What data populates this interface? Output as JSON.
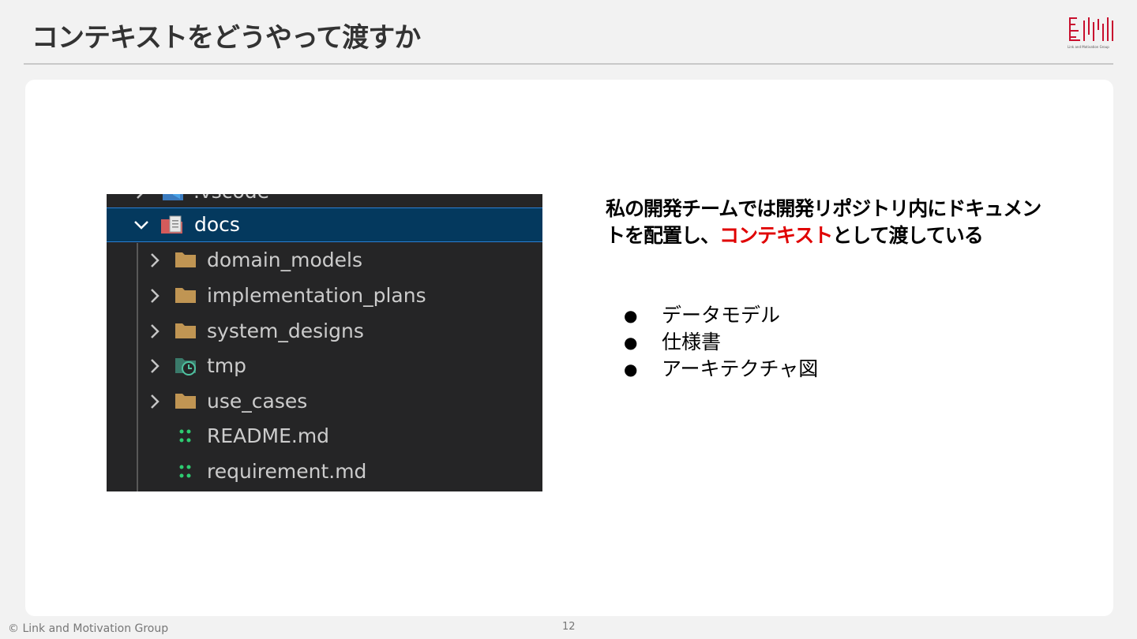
{
  "slide": {
    "title": "コンテキストをどうやって渡すか",
    "logo_text": "Link and Motivation Group",
    "copyright": "© Link and Motivation Group",
    "page_number": "12"
  },
  "explorer": {
    "partial_item": ".vscode",
    "selected_folder": "docs",
    "items": [
      {
        "label": "domain_models",
        "icon": "folder-icon",
        "expandable": true
      },
      {
        "label": "implementation_plans",
        "icon": "folder-icon",
        "expandable": true
      },
      {
        "label": "system_designs",
        "icon": "folder-icon",
        "expandable": true
      },
      {
        "label": "tmp",
        "icon": "temp-folder-icon",
        "expandable": true
      },
      {
        "label": "use_cases",
        "icon": "folder-icon",
        "expandable": true
      },
      {
        "label": "README.md",
        "icon": "markdown-file-icon",
        "expandable": false
      },
      {
        "label": "requirement.md",
        "icon": "markdown-file-icon",
        "expandable": false
      }
    ],
    "colors": {
      "background": "#252526",
      "selected": "#04395e",
      "folder": "#c09553",
      "markdown": "#2ecc71"
    }
  },
  "description": {
    "line_part1": "私の開発チームでは開発リポジトリ内にドキュメントを配置し、",
    "accent": "コンテキスト",
    "line_part2": "として渡している",
    "accent_color": "#e00000"
  },
  "bullets": {
    "marker": "●",
    "items": [
      "データモデル",
      "仕様書",
      "アーキテクチャ図"
    ]
  }
}
